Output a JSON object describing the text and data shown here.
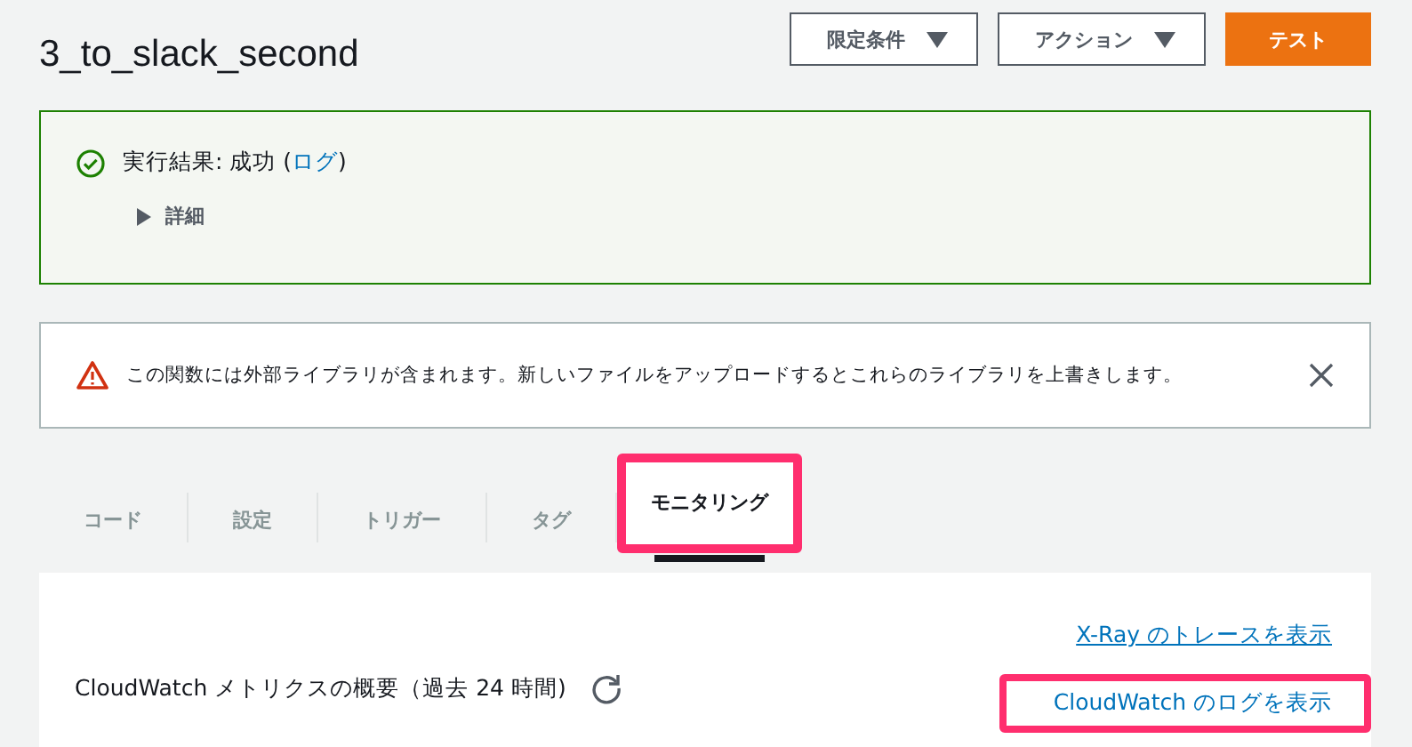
{
  "title": "3_to_slack_second",
  "buttons": [
    {
      "label": "限定条件",
      "kind": "dropdown"
    },
    {
      "label": "アクション",
      "kind": "dropdown"
    },
    {
      "label": "テスト",
      "kind": "primary"
    }
  ],
  "result": {
    "prefix": "実行結果: 成功 (",
    "link": "ログ",
    "suffix": ")",
    "details": "詳細",
    "expanded": false
  },
  "warning": {
    "text": "この関数には外部ライブラリが含まれます。新しいファイルをアップロードするとこれらのライブラリを上書きします。"
  },
  "tabs": [
    {
      "label": "コード",
      "selected": false,
      "highlighted": false
    },
    {
      "label": "設定",
      "selected": false,
      "highlighted": false
    },
    {
      "label": "トリガー",
      "selected": false,
      "highlighted": false
    },
    {
      "label": "タグ",
      "selected": false,
      "highlighted": false
    },
    {
      "label": "モニタリング",
      "selected": true,
      "highlighted": true
    }
  ],
  "monitoring": {
    "title": "CloudWatch メトリクスの概要（過去 24 時間)",
    "links": [
      {
        "label": "X-Ray のトレースを表示",
        "underlined": true,
        "highlighted": false
      },
      {
        "label": "CloudWatch のログを表示",
        "underlined": false,
        "highlighted": true
      }
    ]
  }
}
